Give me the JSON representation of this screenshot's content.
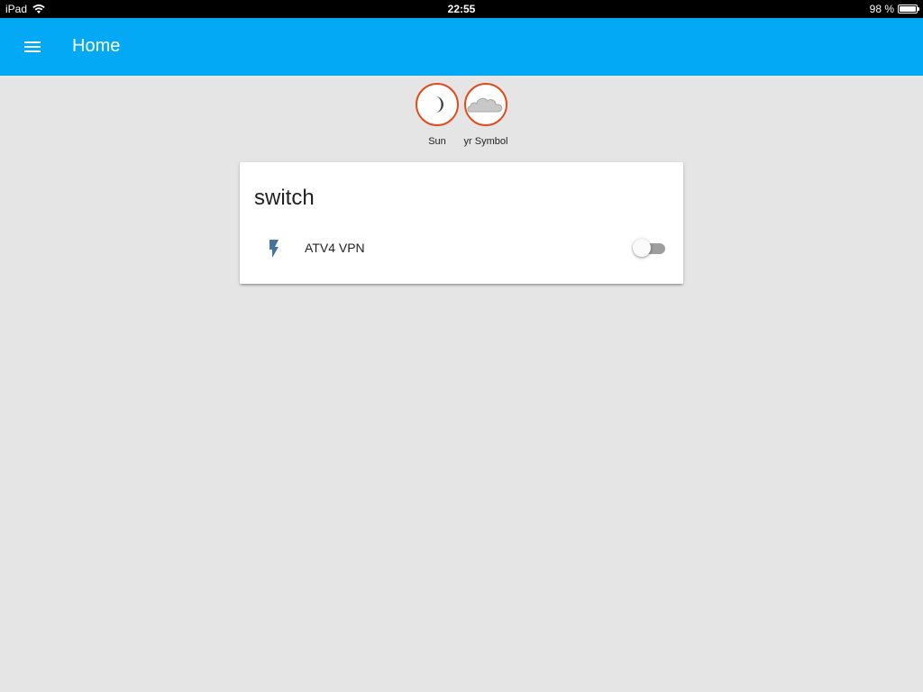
{
  "status_bar": {
    "device": "iPad",
    "time": "22:55",
    "battery_text": "98 %",
    "battery_level": 0.98
  },
  "app_bar": {
    "title": "Home",
    "color": "#03a9f4"
  },
  "badges": [
    {
      "label": "Sun",
      "icon": "moon-icon"
    },
    {
      "label": "yr Symbol",
      "icon": "cloud-icon"
    }
  ],
  "card": {
    "title": "switch",
    "entities": [
      {
        "name": "ATV4 VPN",
        "icon": "flash-icon",
        "state": "off"
      }
    ]
  },
  "colors": {
    "accent": "#03a9f4",
    "badge_border": "#df4c1e",
    "entity_icon": "#44739e",
    "background": "#e5e5e5"
  }
}
